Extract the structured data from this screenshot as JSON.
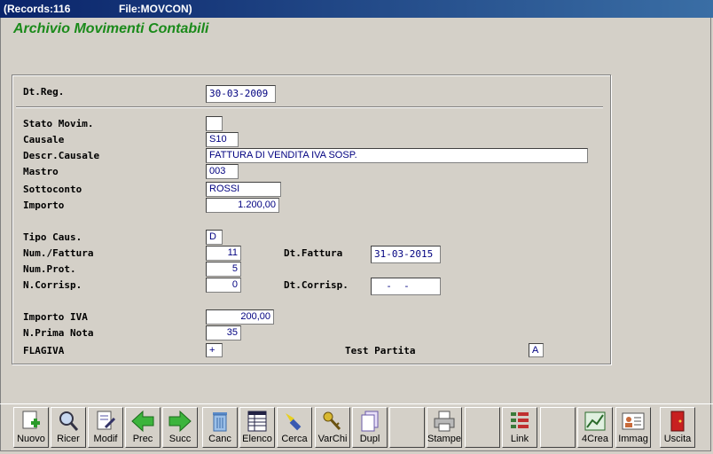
{
  "titlebar": {
    "records": "(Records:116",
    "file": "File:MOVCON)"
  },
  "heading": "Archivio Movimenti Contabili",
  "form": {
    "dt_reg_label": "Dt.Reg.",
    "dt_reg": "30-03-2009",
    "stato_label": "Stato Movim.",
    "stato": "",
    "causale_label": "Causale",
    "causale": "S10",
    "descr_label": "Descr.Causale",
    "descr": "FATTURA DI VENDITA IVA SOSP.",
    "mastro_label": "Mastro",
    "mastro": "003",
    "sottoconto_label": "Sottoconto",
    "sottoconto": "ROSSI",
    "importo_label": "Importo",
    "importo": "1.200,00",
    "tipo_caus_label": "Tipo Caus.",
    "tipo_caus": "D",
    "num_fattura_label": "Num./Fattura",
    "num_fattura": "11",
    "dt_fattura_label": "Dt.Fattura",
    "dt_fattura": "31-03-2015",
    "num_prot_label": "Num.Prot.",
    "num_prot": "5",
    "n_corrisp_label": "N.Corrisp.",
    "n_corrisp": "0",
    "dt_corrisp_label": "Dt.Corrisp.",
    "dt_corrisp": "  -  -",
    "importo_iva_label": "Importo IVA",
    "importo_iva": "200,00",
    "prima_nota_label": "N.Prima Nota",
    "prima_nota": "35",
    "flagiva_label": "FLAGIVA",
    "flagiva": "+",
    "test_partita_label": "Test Partita",
    "test_partita": "A"
  },
  "toolbar": [
    {
      "label": "Nuovo",
      "icon": "new-document-icon"
    },
    {
      "label": "Ricer",
      "icon": "magnifier-icon"
    },
    {
      "label": "Modif",
      "icon": "edit-document-icon"
    },
    {
      "label": "Prec",
      "icon": "arrow-left-icon"
    },
    {
      "label": "Succ",
      "icon": "arrow-right-icon"
    },
    {
      "label": "Canc",
      "icon": "trash-icon"
    },
    {
      "label": "Elenco",
      "icon": "list-grid-icon"
    },
    {
      "label": "Cerca",
      "icon": "flashlight-icon"
    },
    {
      "label": "VarChi",
      "icon": "keys-icon"
    },
    {
      "label": "Dupl",
      "icon": "copy-pages-icon"
    },
    {
      "label": "",
      "icon": ""
    },
    {
      "label": "Stampe",
      "icon": "printer-icon"
    },
    {
      "label": "",
      "icon": ""
    },
    {
      "label": "Link",
      "icon": "link-tree-icon"
    },
    {
      "label": "",
      "icon": ""
    },
    {
      "label": "4Crea",
      "icon": "create-chart-icon"
    },
    {
      "label": "Immag",
      "icon": "id-card-icon"
    },
    {
      "label": "Uscita",
      "icon": "exit-door-icon"
    }
  ],
  "colors": {
    "heading": "#1a8a1a",
    "field_text": "#000080",
    "titlebar": "#0a246a"
  }
}
